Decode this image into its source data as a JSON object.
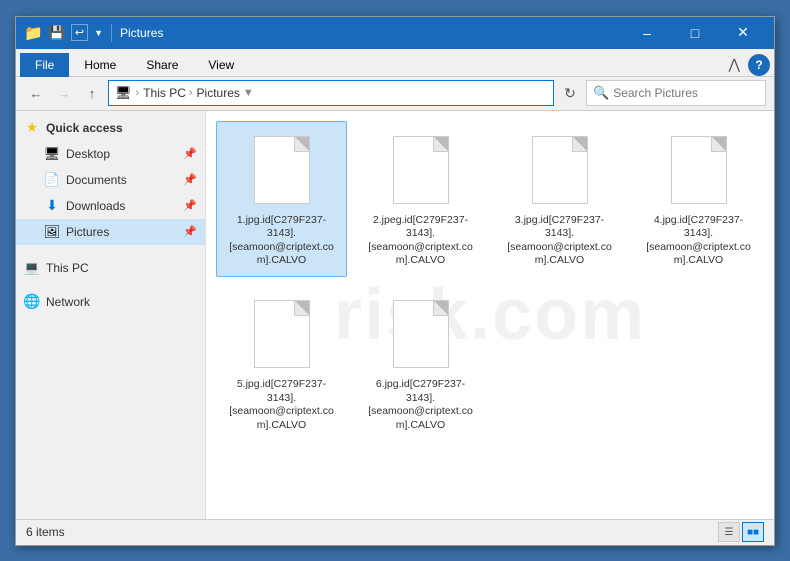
{
  "window": {
    "title": "Pictures",
    "titlebar_icons": [
      "folder-icon",
      "save-icon",
      "undo-icon"
    ]
  },
  "ribbon": {
    "tabs": [
      "File",
      "Home",
      "Share",
      "View"
    ],
    "active_tab": "File"
  },
  "addressbar": {
    "back_disabled": false,
    "forward_disabled": true,
    "breadcrumb": [
      "This PC",
      "Pictures"
    ],
    "search_placeholder": "Search Pictures",
    "search_value": ""
  },
  "sidebar": {
    "quick_access_label": "Quick access",
    "items": [
      {
        "id": "desktop",
        "label": "Desktop",
        "icon": "desktop-icon",
        "pinned": true,
        "indent": 1
      },
      {
        "id": "documents",
        "label": "Documents",
        "icon": "documents-icon",
        "pinned": true,
        "indent": 1
      },
      {
        "id": "downloads",
        "label": "Downloads",
        "icon": "downloads-icon",
        "pinned": true,
        "indent": 1
      },
      {
        "id": "pictures",
        "label": "Pictures",
        "icon": "pictures-icon",
        "pinned": true,
        "indent": 1,
        "active": true
      },
      {
        "id": "thispc",
        "label": "This PC",
        "icon": "thispc-icon",
        "indent": 0
      },
      {
        "id": "network",
        "label": "Network",
        "icon": "network-icon",
        "indent": 0
      }
    ]
  },
  "files": {
    "items": [
      {
        "id": 1,
        "name": "1.jpg.id[C279F237-3143].[seamoon@criptext.com].CALVO"
      },
      {
        "id": 2,
        "name": "2.jpeg.id[C279F237-3143].[seamoon@criptext.com].CALVO"
      },
      {
        "id": 3,
        "name": "3.jpg.id[C279F237-3143].[seamoon@criptext.com].CALVO"
      },
      {
        "id": 4,
        "name": "4.jpg.id[C279F237-3143].[seamoon@criptext.com].CALVO"
      },
      {
        "id": 5,
        "name": "5.jpg.id[C279F237-3143].[seamoon@criptext.com].CALVO"
      },
      {
        "id": 6,
        "name": "6.jpg.id[C279F237-3143].[seamoon@criptext.com].CALVO"
      }
    ]
  },
  "statusbar": {
    "item_count": "6 items",
    "view_mode": "large-icons"
  },
  "watermark": {
    "text": "risk.com"
  }
}
